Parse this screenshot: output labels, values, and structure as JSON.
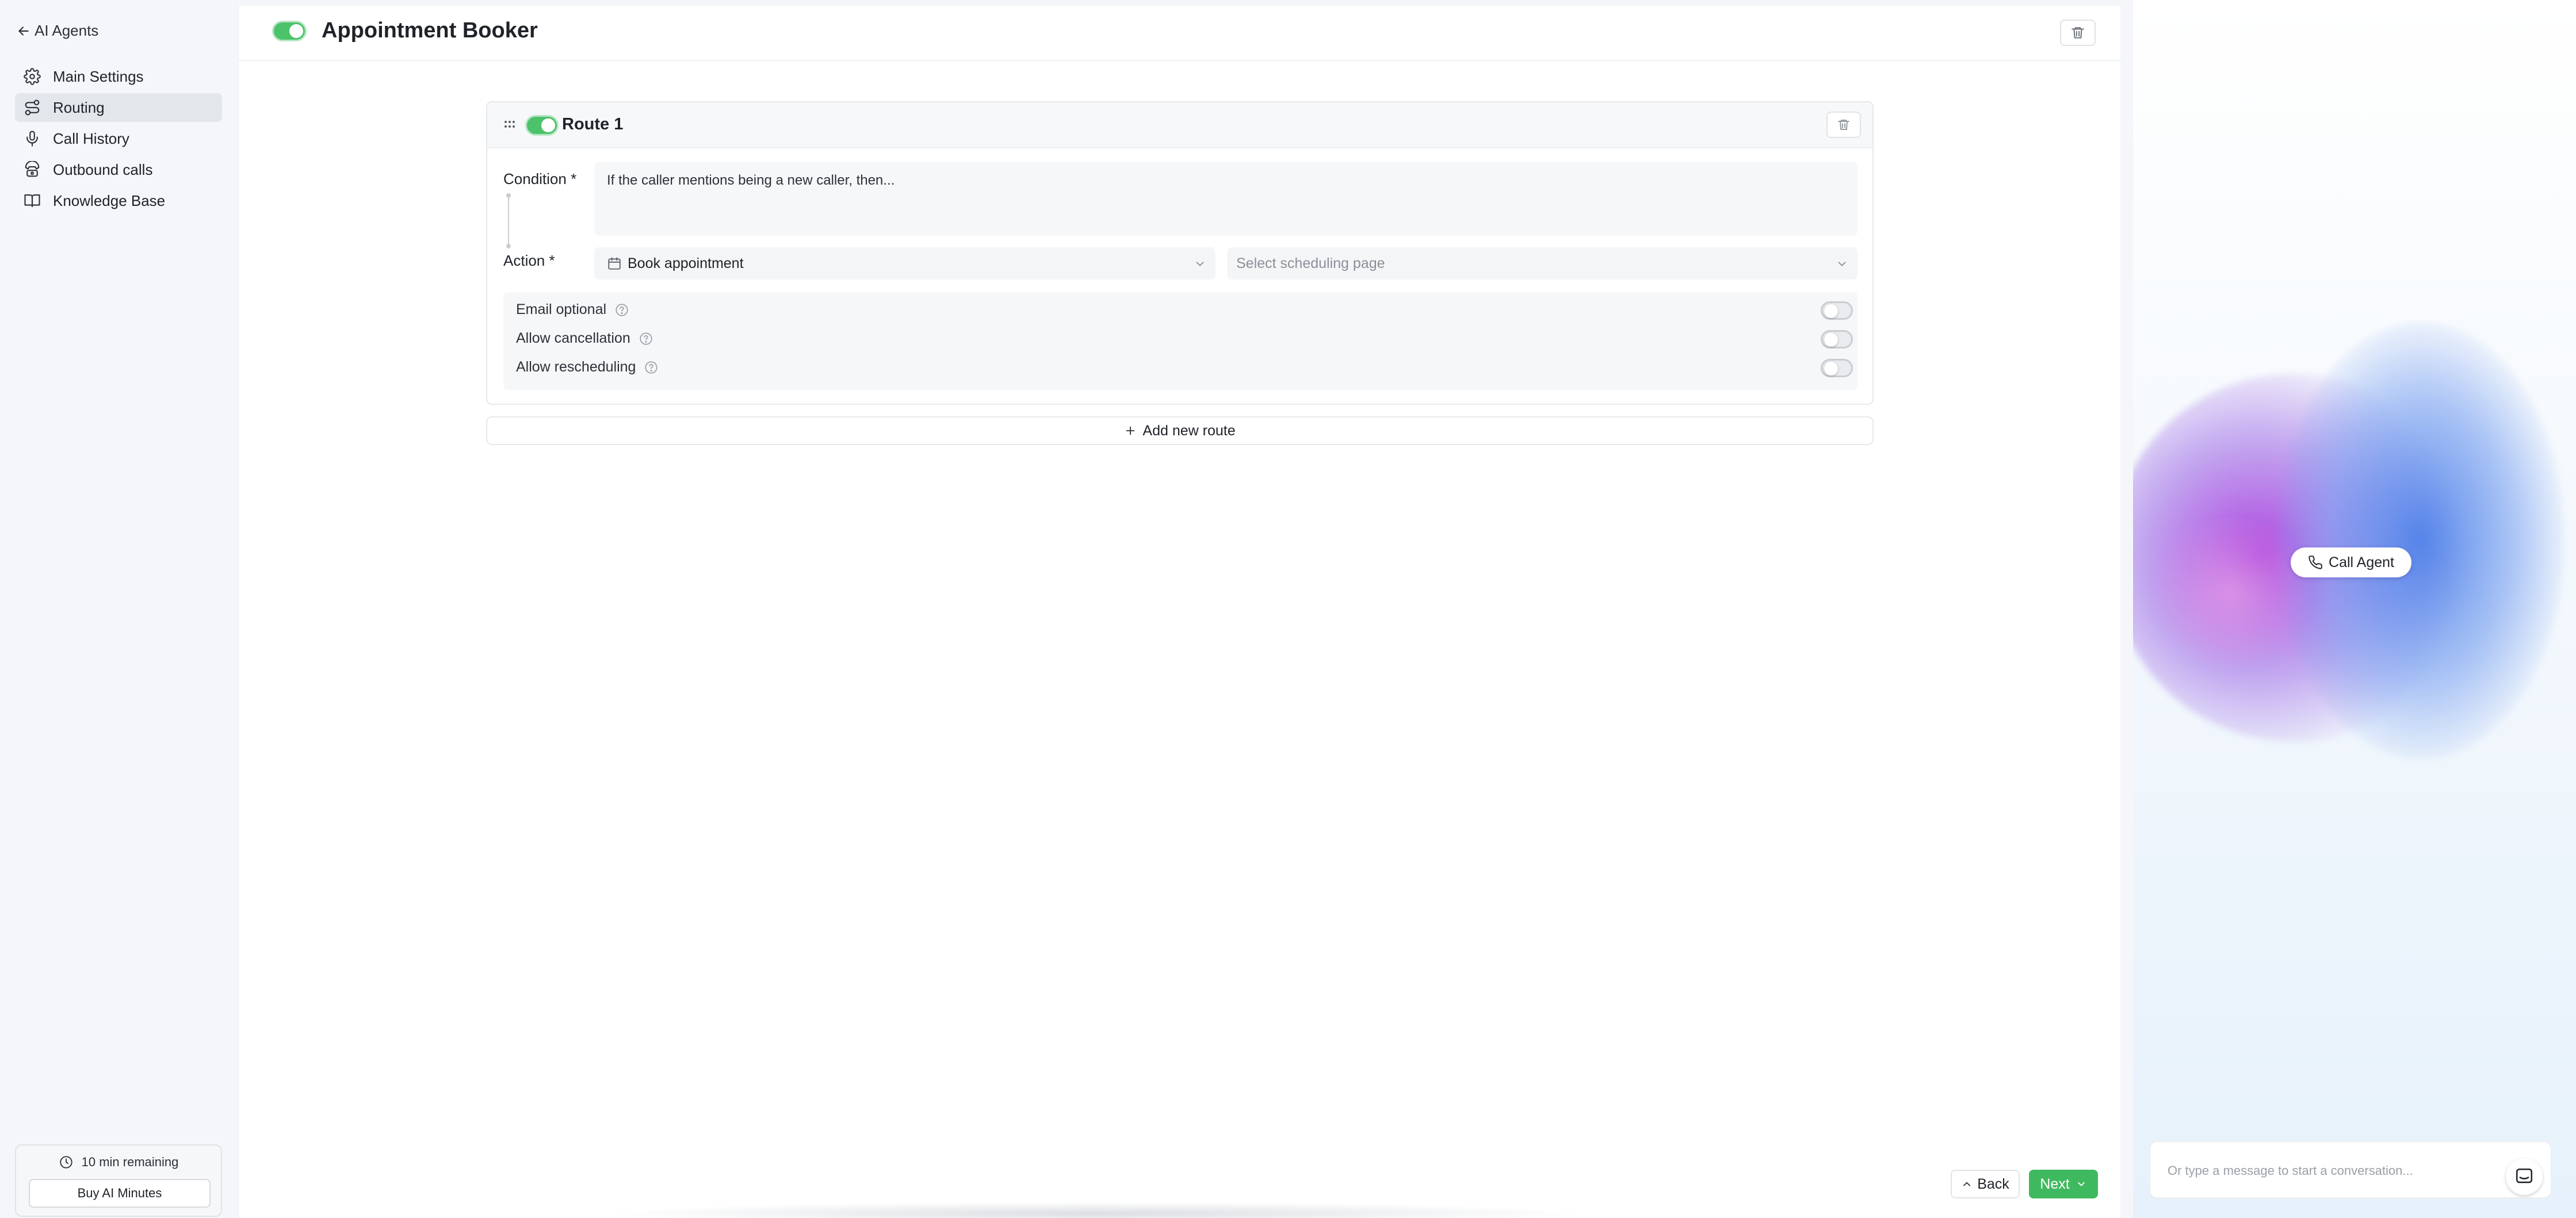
{
  "sidebar": {
    "back_label": "AI Agents",
    "items": [
      {
        "label": "Main Settings",
        "icon": "gear-icon"
      },
      {
        "label": "Routing",
        "icon": "routing-icon",
        "active": true
      },
      {
        "label": "Call History",
        "icon": "microphone-icon"
      },
      {
        "label": "Outbound calls",
        "icon": "outbound-calls-icon"
      },
      {
        "label": "Knowledge Base",
        "icon": "book-icon"
      }
    ],
    "minutes_remaining": "10 min remaining",
    "buy_label": "Buy AI Minutes"
  },
  "header": {
    "title": "Appointment Booker",
    "enabled": true
  },
  "route": {
    "name": "Route 1",
    "enabled": true,
    "condition_label": "Condition",
    "condition_value": "If the caller mentions being a new caller, then...",
    "action_label": "Action",
    "required_mark": "*",
    "action_value": "Book appointment",
    "scheduling_placeholder": "Select scheduling page",
    "options": [
      {
        "label": "Email optional",
        "enabled": false
      },
      {
        "label": "Allow cancellation",
        "enabled": false
      },
      {
        "label": "Allow rescheduling",
        "enabled": false
      }
    ]
  },
  "add_route_label": "Add new route",
  "footer": {
    "back_label": "Back",
    "next_label": "Next"
  },
  "right_panel": {
    "call_label": "Call Agent",
    "chat_placeholder": "Or type a message to start a conversation..."
  },
  "colors": {
    "accent_green": "#3fb95f",
    "toggle_on": "#4cc36a",
    "blob_blue": "#4d7fe8",
    "blob_purple": "#aa3cdc"
  }
}
